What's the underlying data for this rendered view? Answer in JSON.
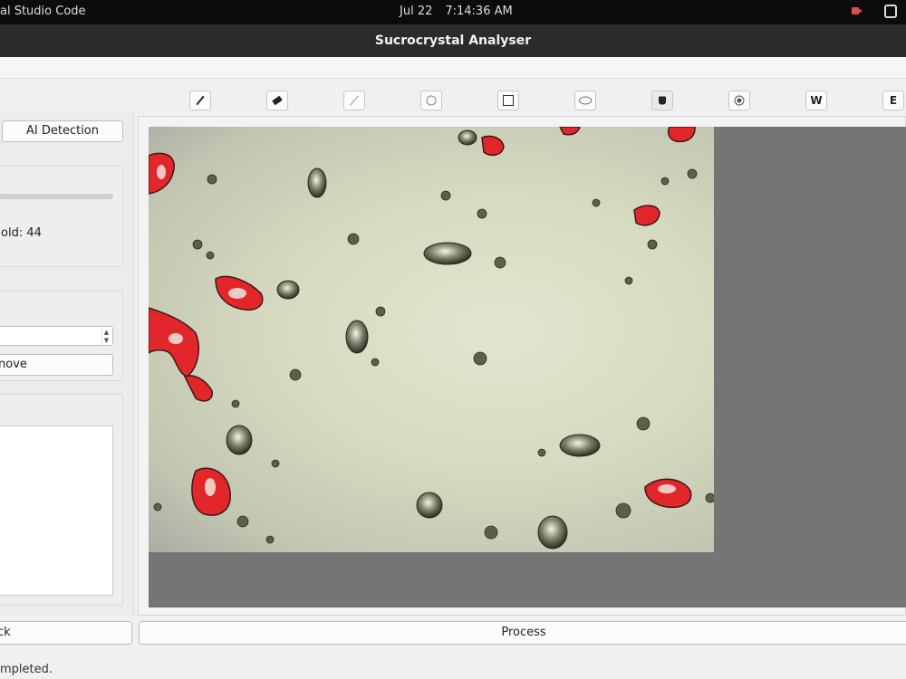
{
  "system_bar": {
    "app_name": "al Studio Code",
    "date": "Jul 22",
    "time": "7:14:36 AM"
  },
  "window": {
    "title": "Sucrocrystal Analyser"
  },
  "toolbar": {
    "tools": [
      {
        "name": "pencil-tool",
        "icon": "pencil-icon",
        "label": ""
      },
      {
        "name": "eraser-tool",
        "icon": "eraser-icon",
        "label": ""
      },
      {
        "name": "line-tool",
        "icon": "line-icon",
        "label": ""
      },
      {
        "name": "circle-tool",
        "icon": "circle-icon",
        "label": ""
      },
      {
        "name": "rectangle-tool",
        "icon": "square-icon",
        "label": ""
      },
      {
        "name": "ellipse-tool",
        "icon": "ellipse-icon",
        "label": ""
      },
      {
        "name": "fill-tool",
        "icon": "paint-bucket-icon",
        "label": ""
      },
      {
        "name": "target-tool",
        "icon": "target-icon",
        "label": ""
      },
      {
        "name": "w-tool",
        "icon": "",
        "label": "W"
      },
      {
        "name": "e-tool",
        "icon": "",
        "label": "E"
      }
    ]
  },
  "sidebar": {
    "ai_detection_label": "AI Detection",
    "threshold_label": "old: 44",
    "threshold_value": 44,
    "remove_label": "nove"
  },
  "bottom": {
    "back_label": "ck",
    "process_label": "Process"
  },
  "status": {
    "text": "mpleted."
  },
  "colors": {
    "system_bar": "#0c0c0c",
    "title_bar": "#2b2b2b",
    "viewport": "#757575",
    "crystal_highlight": "#e3262a"
  }
}
